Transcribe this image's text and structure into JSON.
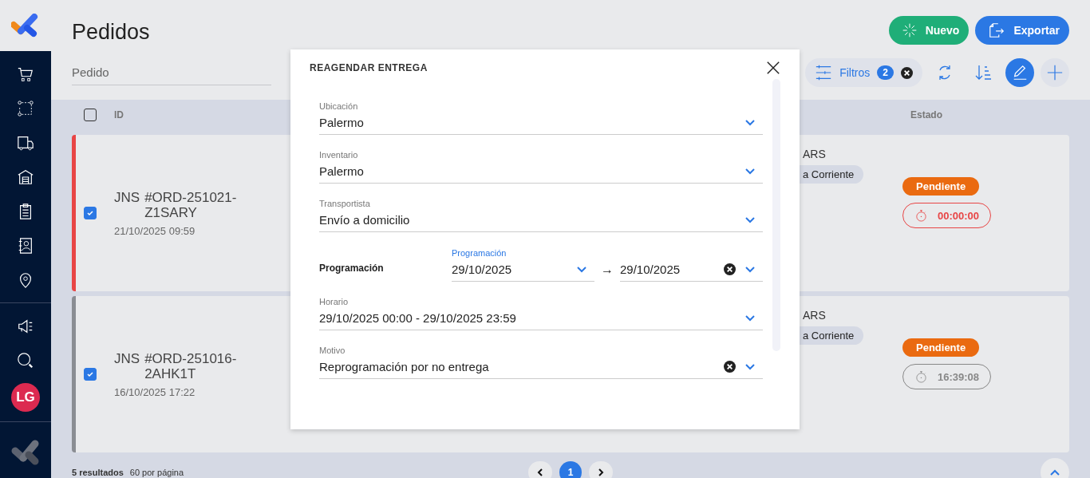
{
  "sidebar": {
    "avatar": "LG"
  },
  "header": {
    "title": "Pedidos",
    "buttons": [
      {
        "label": "Nuevo",
        "kind": "new"
      },
      {
        "label": "Exportar",
        "kind": "export"
      }
    ]
  },
  "toolbar": {
    "search_placeholder": "Pedido",
    "filter_label": "Filtros",
    "filter_count": "2",
    "edit_mode": true
  },
  "table": {
    "select_all": false,
    "columns": [
      "ID",
      "Estado"
    ],
    "rows": [
      {
        "selected": true,
        "color": "#e84545",
        "prefix": "JNS",
        "id": "#ORD-251021-Z1SARY",
        "date": "21/10/2025 09:59",
        "amount": "ARS",
        "payment": "a Corriente",
        "status": "Pendiente",
        "timer": "00:00:00",
        "overdue": true
      },
      {
        "selected": true,
        "color": "#8a8d93",
        "prefix": "JNS",
        "id": "#ORD-251016-2AHK1T",
        "date": "16/10/2025 17:22",
        "amount": "ARS",
        "payment": "a Corriente",
        "status": "Pendiente",
        "timer": "16:39:08",
        "overdue": false
      }
    ]
  },
  "footer": {
    "results": "5 resultados",
    "per_page": "60 por página",
    "pages": [
      {
        "label": "1",
        "selected": true
      }
    ]
  },
  "modal": {
    "title": "REAGENDAR ENTREGA",
    "fields": [
      {
        "kind": "select",
        "label": "Ubicación",
        "value": "Palermo",
        "clearable": false
      },
      {
        "kind": "select",
        "label": "Inventario",
        "value": "Palermo",
        "clearable": false
      },
      {
        "kind": "select",
        "label": "Transportista",
        "value": "Envío a domicilio",
        "clearable": false
      },
      {
        "kind": "range",
        "label": "Programación",
        "range_label": "Programación",
        "from": "29/10/2025",
        "arrow": "→",
        "to": "29/10/2025",
        "clearable": true
      },
      {
        "kind": "select",
        "label": "Horario",
        "value": "29/10/2025 00:00 - 29/10/2025 23:59",
        "clearable": false
      },
      {
        "kind": "select",
        "label": "Motivo",
        "value": "Reprogramación por no entrega",
        "clearable": true
      }
    ]
  }
}
